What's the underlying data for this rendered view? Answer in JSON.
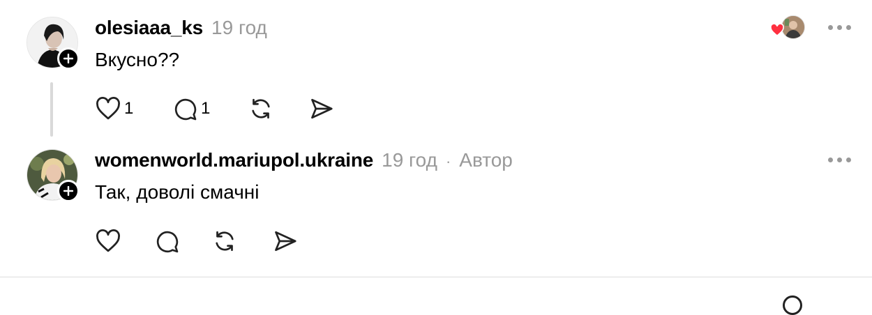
{
  "posts": [
    {
      "username": "olesiaaa_ks",
      "time": "19 год",
      "text": "Вкусно??",
      "likes": "1",
      "replies": "1"
    },
    {
      "username": "womenworld.mariupol.ukraine",
      "time": "19 год",
      "separator": "·",
      "author_label": "Автор",
      "text": "Так, доволі смачні"
    }
  ],
  "colors": {
    "meta": "#999999",
    "liked_heart": "#ff3040",
    "divider": "#dcdcdc"
  },
  "icons": [
    "heart-icon",
    "comment-icon",
    "repost-icon",
    "share-icon",
    "more-icon",
    "plus-icon"
  ]
}
